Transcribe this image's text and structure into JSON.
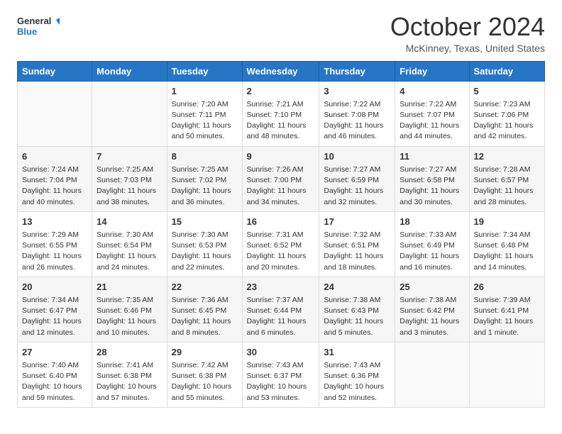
{
  "header": {
    "logo_line1": "General",
    "logo_line2": "Blue",
    "title": "October 2024",
    "subtitle": "McKinney, Texas, United States"
  },
  "days_of_week": [
    "Sunday",
    "Monday",
    "Tuesday",
    "Wednesday",
    "Thursday",
    "Friday",
    "Saturday"
  ],
  "weeks": [
    [
      {
        "day": "",
        "detail": ""
      },
      {
        "day": "",
        "detail": ""
      },
      {
        "day": "1",
        "detail": "Sunrise: 7:20 AM\nSunset: 7:11 PM\nDaylight: 11 hours and 50 minutes."
      },
      {
        "day": "2",
        "detail": "Sunrise: 7:21 AM\nSunset: 7:10 PM\nDaylight: 11 hours and 48 minutes."
      },
      {
        "day": "3",
        "detail": "Sunrise: 7:22 AM\nSunset: 7:08 PM\nDaylight: 11 hours and 46 minutes."
      },
      {
        "day": "4",
        "detail": "Sunrise: 7:22 AM\nSunset: 7:07 PM\nDaylight: 11 hours and 44 minutes."
      },
      {
        "day": "5",
        "detail": "Sunrise: 7:23 AM\nSunset: 7:06 PM\nDaylight: 11 hours and 42 minutes."
      }
    ],
    [
      {
        "day": "6",
        "detail": "Sunrise: 7:24 AM\nSunset: 7:04 PM\nDaylight: 11 hours and 40 minutes."
      },
      {
        "day": "7",
        "detail": "Sunrise: 7:25 AM\nSunset: 7:03 PM\nDaylight: 11 hours and 38 minutes."
      },
      {
        "day": "8",
        "detail": "Sunrise: 7:25 AM\nSunset: 7:02 PM\nDaylight: 11 hours and 36 minutes."
      },
      {
        "day": "9",
        "detail": "Sunrise: 7:26 AM\nSunset: 7:00 PM\nDaylight: 11 hours and 34 minutes."
      },
      {
        "day": "10",
        "detail": "Sunrise: 7:27 AM\nSunset: 6:59 PM\nDaylight: 11 hours and 32 minutes."
      },
      {
        "day": "11",
        "detail": "Sunrise: 7:27 AM\nSunset: 6:58 PM\nDaylight: 11 hours and 30 minutes."
      },
      {
        "day": "12",
        "detail": "Sunrise: 7:28 AM\nSunset: 6:57 PM\nDaylight: 11 hours and 28 minutes."
      }
    ],
    [
      {
        "day": "13",
        "detail": "Sunrise: 7:29 AM\nSunset: 6:55 PM\nDaylight: 11 hours and 26 minutes."
      },
      {
        "day": "14",
        "detail": "Sunrise: 7:30 AM\nSunset: 6:54 PM\nDaylight: 11 hours and 24 minutes."
      },
      {
        "day": "15",
        "detail": "Sunrise: 7:30 AM\nSunset: 6:53 PM\nDaylight: 11 hours and 22 minutes."
      },
      {
        "day": "16",
        "detail": "Sunrise: 7:31 AM\nSunset: 6:52 PM\nDaylight: 11 hours and 20 minutes."
      },
      {
        "day": "17",
        "detail": "Sunrise: 7:32 AM\nSunset: 6:51 PM\nDaylight: 11 hours and 18 minutes."
      },
      {
        "day": "18",
        "detail": "Sunrise: 7:33 AM\nSunset: 6:49 PM\nDaylight: 11 hours and 16 minutes."
      },
      {
        "day": "19",
        "detail": "Sunrise: 7:34 AM\nSunset: 6:48 PM\nDaylight: 11 hours and 14 minutes."
      }
    ],
    [
      {
        "day": "20",
        "detail": "Sunrise: 7:34 AM\nSunset: 6:47 PM\nDaylight: 11 hours and 12 minutes."
      },
      {
        "day": "21",
        "detail": "Sunrise: 7:35 AM\nSunset: 6:46 PM\nDaylight: 11 hours and 10 minutes."
      },
      {
        "day": "22",
        "detail": "Sunrise: 7:36 AM\nSunset: 6:45 PM\nDaylight: 11 hours and 8 minutes."
      },
      {
        "day": "23",
        "detail": "Sunrise: 7:37 AM\nSunset: 6:44 PM\nDaylight: 11 hours and 6 minutes."
      },
      {
        "day": "24",
        "detail": "Sunrise: 7:38 AM\nSunset: 6:43 PM\nDaylight: 11 hours and 5 minutes."
      },
      {
        "day": "25",
        "detail": "Sunrise: 7:38 AM\nSunset: 6:42 PM\nDaylight: 11 hours and 3 minutes."
      },
      {
        "day": "26",
        "detail": "Sunrise: 7:39 AM\nSunset: 6:41 PM\nDaylight: 11 hours and 1 minute."
      }
    ],
    [
      {
        "day": "27",
        "detail": "Sunrise: 7:40 AM\nSunset: 6:40 PM\nDaylight: 10 hours and 59 minutes."
      },
      {
        "day": "28",
        "detail": "Sunrise: 7:41 AM\nSunset: 6:38 PM\nDaylight: 10 hours and 57 minutes."
      },
      {
        "day": "29",
        "detail": "Sunrise: 7:42 AM\nSunset: 6:38 PM\nDaylight: 10 hours and 55 minutes."
      },
      {
        "day": "30",
        "detail": "Sunrise: 7:43 AM\nSunset: 6:37 PM\nDaylight: 10 hours and 53 minutes."
      },
      {
        "day": "31",
        "detail": "Sunrise: 7:43 AM\nSunset: 6:36 PM\nDaylight: 10 hours and 52 minutes."
      },
      {
        "day": "",
        "detail": ""
      },
      {
        "day": "",
        "detail": ""
      }
    ]
  ]
}
